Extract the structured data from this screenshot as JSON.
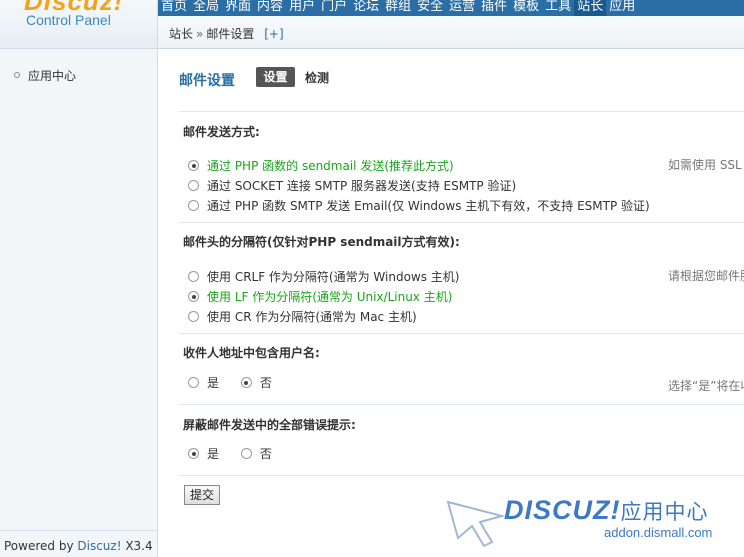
{
  "logo": {
    "brand": "Discuz!",
    "subtitle": "Control Panel"
  },
  "topnav": {
    "items": [
      "首页",
      "全局",
      "界面",
      "内容",
      "用户",
      "门户",
      "论坛",
      "群组",
      "安全",
      "运营",
      "插件",
      "模板",
      "工具",
      "站长",
      "应用"
    ],
    "active_index": 13
  },
  "breadcrumb": {
    "parent": "站长",
    "separator": "»",
    "current": "邮件设置",
    "add_label": "[+]"
  },
  "sidebar": {
    "items": [
      {
        "label": "应用中心"
      }
    ],
    "footer_prefix": "Powered by ",
    "footer_brand": "Discuz!",
    "footer_version": " X3.4"
  },
  "main": {
    "title": "邮件设置",
    "tabs": [
      {
        "label": "设置",
        "active": true
      },
      {
        "label": "检测",
        "active": false
      }
    ],
    "sections": [
      {
        "title": "邮件发送方式:",
        "options": [
          {
            "label": "通过 PHP 函数的 sendmail 发送(推荐此方式)",
            "checked": true
          },
          {
            "label": "通过 SOCKET 连接 SMTP 服务器发送(支持 ESMTP 验证)",
            "checked": false
          },
          {
            "label": "通过 PHP 函数 SMTP 发送 Email(仅 Windows 主机下有效，不支持 ESMTP 验证)",
            "checked": false
          }
        ],
        "hint": "如需使用 SSL"
      },
      {
        "title": "邮件头的分隔符(仅针对PHP sendmail方式有效):",
        "options": [
          {
            "label": "使用 CRLF 作为分隔符(通常为 Windows 主机)",
            "checked": false
          },
          {
            "label": "使用 LF 作为分隔符(通常为 Unix/Linux 主机)",
            "checked": true
          },
          {
            "label": "使用 CR 作为分隔符(通常为 Mac 主机)",
            "checked": false
          }
        ],
        "hint": "请根据您邮件服"
      },
      {
        "title": "收件人地址中包含用户名:",
        "options": [
          {
            "label": "是",
            "checked": false
          },
          {
            "label": "否",
            "checked": true
          }
        ],
        "hint": "选择“是”将在收"
      },
      {
        "title": "屏蔽邮件发送中的全部错误提示:",
        "options": [
          {
            "label": "是",
            "checked": true
          },
          {
            "label": "否",
            "checked": false
          }
        ],
        "hint": ""
      }
    ],
    "submit_label": "提交"
  },
  "watermark": {
    "brand": "DISCUZ!",
    "brand_cn": "应用中心",
    "url": "addon.dismall.com"
  },
  "colors": {
    "accent": "#2b6ea6",
    "checked_text": "#1aa51a",
    "logo_orange": "#f4a11b"
  }
}
